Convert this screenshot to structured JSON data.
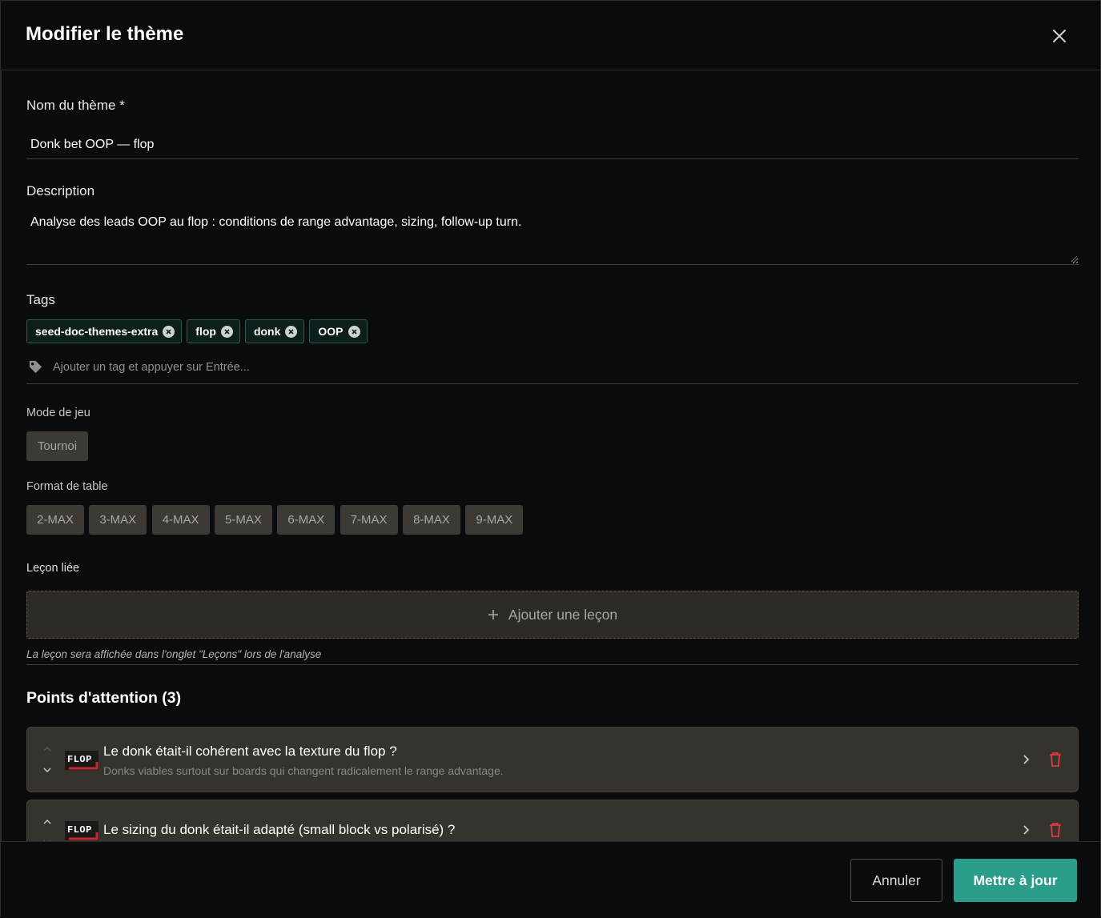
{
  "modal": {
    "title": "Modifier le thème"
  },
  "form": {
    "name_label": "Nom du thème *",
    "name_value": "Donk bet OOP — flop",
    "description_label": "Description",
    "description_value": "Analyse des leads OOP au flop : conditions de range advantage, sizing, follow-up turn.",
    "tags_label": "Tags",
    "tags": [
      "seed-doc-themes-extra",
      "flop",
      "donk",
      "OOP"
    ],
    "tag_placeholder": "Ajouter un tag et appuyer sur Entrée...",
    "game_mode_label": "Mode de jeu",
    "game_mode_option": "Tournoi",
    "table_format_label": "Format de table",
    "table_formats": [
      "2-MAX",
      "3-MAX",
      "4-MAX",
      "5-MAX",
      "6-MAX",
      "7-MAX",
      "8-MAX",
      "9-MAX"
    ],
    "lesson_label": "Leçon liée",
    "add_lesson_label": "Ajouter une leçon",
    "lesson_hint": "La leçon sera affichée dans l'onglet \"Leçons\" lors de l'analyse"
  },
  "points": {
    "title": "Points d'attention (3)",
    "items": [
      {
        "street": "FLOP",
        "title": "Le donk était-il cohérent avec la texture du flop ?",
        "subtitle": "Donks viables surtout sur boards qui changent radicalement le range advantage."
      },
      {
        "street": "FLOP",
        "title": "Le sizing du donk était-il adapté (small block vs polarisé) ?",
        "subtitle": ""
      }
    ]
  },
  "footer": {
    "cancel_label": "Annuler",
    "update_label": "Mettre à jour"
  },
  "colors": {
    "accent": "#2a9d8a",
    "danger": "#e0393e",
    "tag_bg": "#0d1f1c"
  }
}
